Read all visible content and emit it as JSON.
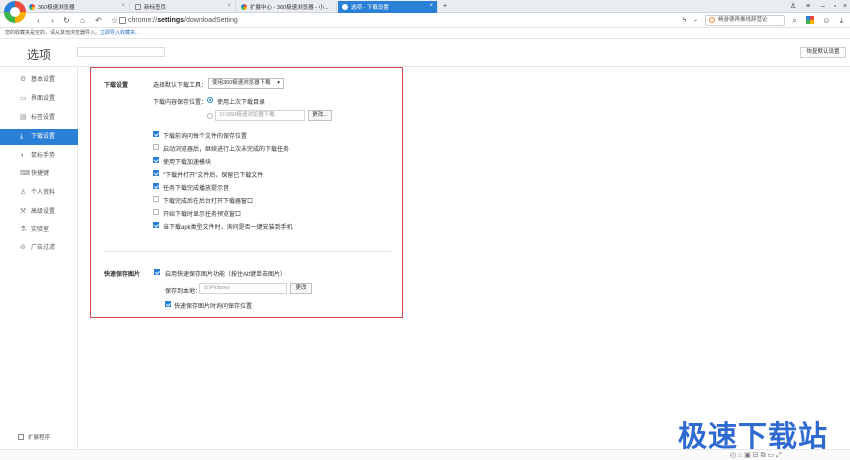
{
  "colors": {
    "accent": "#2a7fd6",
    "highlight_frame": "#d64b4b",
    "watermark": "#2f6ad1"
  },
  "tabs": [
    {
      "label": "360极速浏览器",
      "icon": "browser-logo-icon"
    },
    {
      "label": "新标签页",
      "icon": "page-icon"
    },
    {
      "label": "扩展中心 - 360极速浏览器 - 小...",
      "icon": "extension-icon"
    },
    {
      "label": "选项 - 下载设置",
      "icon": "settings-icon",
      "active": true
    }
  ],
  "address": {
    "prefix": "chrome://",
    "bold": "settings",
    "suffix": "/downloadSetting"
  },
  "search": {
    "placeholder": "畅游德再推线辞营论"
  },
  "favbar": {
    "text": "您的收藏夹是空的，请从其他浏览器导入。",
    "link": "立即导入收藏夹..."
  },
  "settings": {
    "title": "选项",
    "restore_label": "恢复默认设置"
  },
  "sidebar": {
    "items": [
      {
        "label": "基本设置",
        "icon": "gear-icon"
      },
      {
        "label": "界面设置",
        "icon": "layout-icon"
      },
      {
        "label": "标签设置",
        "icon": "tab-icon"
      },
      {
        "label": "下载设置",
        "icon": "download-icon",
        "active": true
      },
      {
        "label": "鼠标手势",
        "icon": "mouse-icon"
      },
      {
        "label": "快捷键",
        "icon": "keyboard-icon"
      },
      {
        "label": "个人资料",
        "icon": "person-icon"
      },
      {
        "label": "高级设置",
        "icon": "advanced-icon"
      },
      {
        "label": "实验室",
        "icon": "lab-icon"
      },
      {
        "label": "广告过滤",
        "icon": "block-icon"
      }
    ],
    "extensions_label": "扩展程序"
  },
  "download": {
    "section_label": "下载设置",
    "tool_label": "选择默认下载工具：",
    "tool_value": "使用360极速浏览器下载",
    "location_label": "下载内容保存位置：",
    "radio_last": "使用上次下载目录",
    "path_value": "D:\\360极速浏览器下载",
    "change_label": "更改...",
    "options": [
      {
        "label": "下载前询问每个文件的保存位置",
        "checked": true
      },
      {
        "label": "启动浏览器后，继续进行上次未完成的下载任务",
        "checked": false
      },
      {
        "label": "使用下载加速模块",
        "checked": true
      },
      {
        "label": "\"下载并打开\"文件后，保留已下载文件",
        "checked": true
      },
      {
        "label": "任务下载完成播放提示音",
        "checked": true
      },
      {
        "label": "下载完成后在后台打开下载器窗口",
        "checked": false
      },
      {
        "label": "开始下载时显示任务预览窗口",
        "checked": false
      },
      {
        "label": "当下载apk类型文件时，询问是否一键安装到手机",
        "checked": true
      }
    ]
  },
  "quicksave": {
    "section_label": "快速保存图片",
    "enable_label": "启用快速保存图片功能（按住Alt键单击图片）",
    "enable_checked": true,
    "path_label": "保存到本地：",
    "path_value": "d:\\Pictures",
    "change_label": "更改",
    "ask_label": "快速保存图片时询问保存位置",
    "ask_checked": true
  },
  "watermark": "极速下载站"
}
